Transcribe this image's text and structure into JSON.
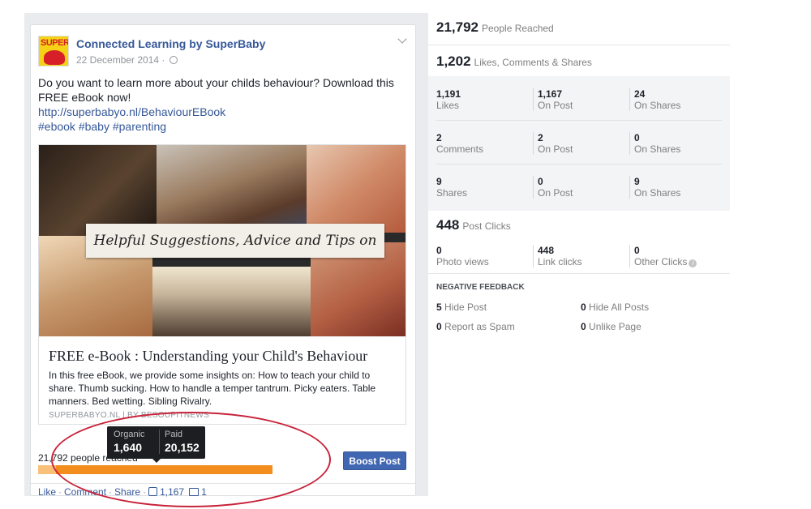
{
  "post": {
    "page_name": "Connected Learning by SuperBaby",
    "avatar_text": "SUPER",
    "date": "22 December 2014 ·",
    "text_line1": "Do you want to learn more about your childs behaviour? Download this",
    "text_line2": "FREE eBook now!",
    "link_url": "http://superbabyo.nl/BehaviourEBook",
    "hashtags": "#ebook #baby #parenting",
    "image_caption": "Helpful Suggestions, Advice and Tips on",
    "link_title": "FREE e-Book : Understanding your Child's Behaviour",
    "link_description": "In this free eBook, we provide some insights on: How to teach your child to share. Thumb sucking. How to handle a temper tantrum. Picky eaters. Table manners. Bed wetting. Sibling Rivalry.",
    "link_domain": "SUPERBABYO.NL | BY BESOUPITNEWS",
    "reach_text": "21,792 people reached",
    "boost_label": "Boost Post",
    "actions": {
      "like": "Like",
      "comment": "Comment",
      "share": "Share",
      "like_count": "1,167",
      "comment_count": "1"
    },
    "tooltip": {
      "organic_label": "Organic",
      "organic_value": "1,640",
      "paid_label": "Paid",
      "paid_value": "20,152"
    },
    "reach_split": {
      "organic": 1640,
      "paid": 20152
    }
  },
  "insights": {
    "people_reached": {
      "value": "21,792",
      "label": "People Reached"
    },
    "engagement": {
      "value": "1,202",
      "label": "Likes, Comments & Shares"
    },
    "grid": [
      [
        {
          "n": "1,191",
          "l": "Likes"
        },
        {
          "n": "1,167",
          "l": "On Post"
        },
        {
          "n": "24",
          "l": "On Shares"
        }
      ],
      [
        {
          "n": "2",
          "l": "Comments"
        },
        {
          "n": "2",
          "l": "On Post"
        },
        {
          "n": "0",
          "l": "On Shares"
        }
      ],
      [
        {
          "n": "9",
          "l": "Shares"
        },
        {
          "n": "0",
          "l": "On Post"
        },
        {
          "n": "9",
          "l": "On Shares"
        }
      ]
    ],
    "post_clicks": {
      "value": "448",
      "label": "Post Clicks"
    },
    "clicks": [
      {
        "n": "0",
        "l": "Photo views"
      },
      {
        "n": "448",
        "l": "Link clicks"
      },
      {
        "n": "0",
        "l": "Other Clicks"
      }
    ],
    "negative_title": "NEGATIVE FEEDBACK",
    "negative": {
      "hide_post": {
        "n": "5",
        "l": "Hide Post"
      },
      "hide_all": {
        "n": "0",
        "l": "Hide All Posts"
      },
      "spam": {
        "n": "0",
        "l": "Report as Spam"
      },
      "unlike": {
        "n": "0",
        "l": "Unlike Page"
      }
    }
  },
  "colors": {
    "facebook_blue": "#4267b2",
    "link_blue": "#365899",
    "reach_bar_paid": "#f28d1e",
    "reach_bar_organic": "#f9c07a",
    "annotation_red": "#c8233a"
  }
}
